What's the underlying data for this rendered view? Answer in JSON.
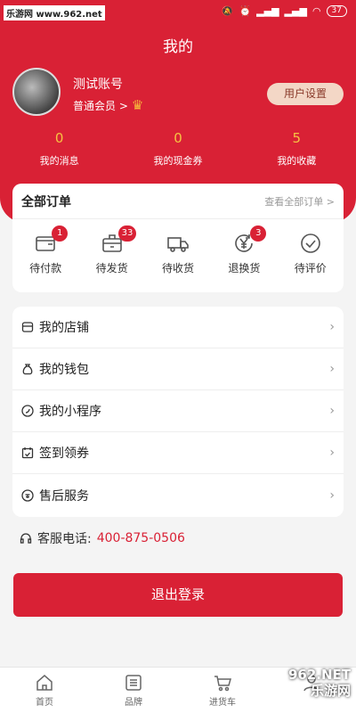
{
  "status_bar": {
    "source": "乐游网 www.962.net",
    "battery": "37"
  },
  "header": {
    "title": "我的"
  },
  "profile": {
    "username": "测试账号",
    "member_level": "普通会员 >",
    "settings_label": "用户设置"
  },
  "stats": [
    {
      "value": "0",
      "label": "我的消息"
    },
    {
      "value": "0",
      "label": "我的现金券"
    },
    {
      "value": "5",
      "label": "我的收藏"
    }
  ],
  "orders": {
    "title": "全部订单",
    "view_all": "查看全部订单 >",
    "items": [
      {
        "label": "待付款",
        "badge": "1",
        "icon": "wallet-icon"
      },
      {
        "label": "待发货",
        "badge": "33",
        "icon": "package-icon"
      },
      {
        "label": "待收货",
        "badge": "",
        "icon": "truck-icon"
      },
      {
        "label": "退换货",
        "badge": "3",
        "icon": "yen-return-icon"
      },
      {
        "label": "待评价",
        "badge": "",
        "icon": "check-circle-icon"
      }
    ]
  },
  "menu": [
    {
      "label": "我的店铺",
      "icon": "store-icon"
    },
    {
      "label": "我的钱包",
      "icon": "money-bag-icon"
    },
    {
      "label": "我的小程序",
      "icon": "mini-program-icon"
    },
    {
      "label": "签到领券",
      "icon": "calendar-check-icon"
    },
    {
      "label": "售后服务",
      "icon": "after-sales-icon"
    }
  ],
  "service": {
    "label": "客服电话:",
    "phone": "400-875-0506"
  },
  "logout_label": "退出登录",
  "tabbar": [
    {
      "label": "首页",
      "icon": "home-icon"
    },
    {
      "label": "品牌",
      "icon": "list-icon"
    },
    {
      "label": "进货车",
      "icon": "cart-icon"
    },
    {
      "label": "",
      "icon": "user-icon"
    }
  ],
  "watermark": {
    "line1": "962.NET",
    "line2": "乐游网"
  },
  "colors": {
    "primary": "#d92135",
    "stat_value": "#f6c242",
    "settings_bg": "#f3d7c6"
  }
}
